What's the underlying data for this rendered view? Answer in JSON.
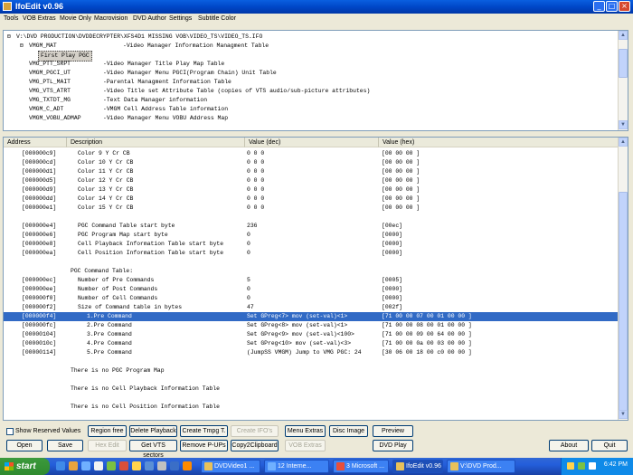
{
  "window": {
    "title": "IfoEdit v0.96",
    "min": "_",
    "max": "□",
    "close": "×"
  },
  "menu": [
    "Tools",
    "VOB Extras",
    "Movie Only",
    "Macrovision",
    "DVD Author",
    "Settings",
    "Subtitle Color"
  ],
  "tree": {
    "root": "V:\\DVD PRODUCTION\\DVDDECRYPTER\\XFS4D1 MISSING VOB\\VIDEO_TS\\VIDEO_TS.IFO",
    "items": [
      {
        "key": "VMGM_MAT",
        "desc": "-Video Manager Information Managment Table"
      },
      {
        "key": "First Play PGC",
        "desc": ""
      },
      {
        "key": "VMG_PTT_SRPT",
        "desc": "-Video Manager Title Play Map Table"
      },
      {
        "key": "VMGM_PGCI_UT",
        "desc": "-Video Manager Menu PGCI(Program Chain) Unit Table"
      },
      {
        "key": "VMG_PTL_MAIT",
        "desc": "-Parental Managment Information Table"
      },
      {
        "key": "VMG_VTS_ATRT",
        "desc": "-Video Title set Attribute Table (copies of VTS audio/sub-picture attributes)"
      },
      {
        "key": "VMG_TXTDT_MG",
        "desc": "-Text Data Manager information"
      },
      {
        "key": "VMGM_C_ADT",
        "desc": "-VMGM Cell Address Table information"
      },
      {
        "key": "VMGM_VOBU_ADMAP",
        "desc": "-Video Manager Menu VOBU Address Map"
      }
    ]
  },
  "table": {
    "headers": [
      "Address",
      "Description",
      "Value (dec)",
      "Value (hex)"
    ],
    "rows": [
      {
        "addr": "[000000c9]",
        "desc": "Color 9 Y Cr CB",
        "dec": "0 0 0",
        "hex": "[00 00 00 ]"
      },
      {
        "addr": "[000000cd]",
        "desc": "Color 10 Y Cr CB",
        "dec": "0 0 0",
        "hex": "[00 00 00 ]"
      },
      {
        "addr": "[000000d1]",
        "desc": "Color 11 Y Cr CB",
        "dec": "0 0 0",
        "hex": "[00 00 00 ]"
      },
      {
        "addr": "[000000d5]",
        "desc": "Color 12 Y Cr CB",
        "dec": "0 0 0",
        "hex": "[00 00 00 ]"
      },
      {
        "addr": "[000000d9]",
        "desc": "Color 13 Y Cr CB",
        "dec": "0 0 0",
        "hex": "[00 00 00 ]"
      },
      {
        "addr": "[000000dd]",
        "desc": "Color 14 Y Cr CB",
        "dec": "0 0 0",
        "hex": "[00 00 00 ]"
      },
      {
        "addr": "[000000e1]",
        "desc": "Color 15 Y Cr CB",
        "dec": "0 0 0",
        "hex": "[00 00 00 ]"
      },
      {
        "addr": "",
        "desc": "",
        "dec": "",
        "hex": ""
      },
      {
        "addr": "[000000e4]",
        "desc": "PGC Command Table start byte",
        "dec": "236",
        "hex": "[00ec]"
      },
      {
        "addr": "[000000e6]",
        "desc": "PGC Program Map start byte",
        "dec": "0",
        "hex": "[0000]"
      },
      {
        "addr": "[000000e8]",
        "desc": "Cell Playback Information Table start byte",
        "dec": "0",
        "hex": "[0000]"
      },
      {
        "addr": "[000000ea]",
        "desc": "Cell Position Information Table start byte",
        "dec": "0",
        "hex": "[0000]"
      },
      {
        "addr": "",
        "desc": "",
        "dec": "",
        "hex": ""
      },
      {
        "addr": "",
        "desc": "PGC Command Table:",
        "dec": "",
        "hex": "",
        "section": true
      },
      {
        "addr": "[000000ec]",
        "desc": "Number of Pre Commands",
        "dec": "5",
        "hex": "[0005]"
      },
      {
        "addr": "[000000ee]",
        "desc": "Number of Post Commands",
        "dec": "0",
        "hex": "[0000]"
      },
      {
        "addr": "[000000f0]",
        "desc": "Number of Cell Commands",
        "dec": "0",
        "hex": "[0000]"
      },
      {
        "addr": "[000000f2]",
        "desc": "Size of Command table in bytes",
        "dec": "47",
        "hex": "[002f]"
      },
      {
        "addr": "[000000f4]",
        "desc": "1.Pre Command",
        "dec": "Set GPreg<7> mov (set-val)<1>",
        "hex": "[71 00 00 07 00 01 00 00 ]",
        "selected": true,
        "indent": true
      },
      {
        "addr": "[000000fc]",
        "desc": "2.Pre Command",
        "dec": "Set GPreg<8> mov (set-val)<1>",
        "hex": "[71 00 00 08 00 01 00 00 ]",
        "indent": true
      },
      {
        "addr": "[00000104]",
        "desc": "3.Pre Command",
        "dec": "Set GPreg<9> mov (set-val)<100>",
        "hex": "[71 00 00 09 00 64 00 00 ]",
        "indent": true
      },
      {
        "addr": "[0000010c]",
        "desc": "4.Pre Command",
        "dec": "Set GPreg<10> mov (set-val)<3>",
        "hex": "[71 00 00 0a 00 03 00 00 ]",
        "indent": true
      },
      {
        "addr": "[00000114]",
        "desc": "5.Pre Command",
        "dec": "(JumpSS VMGM) Jump to VMG PGC: 24",
        "hex": "[30 06 00 18 00 c0 00 00 ]",
        "indent": true
      },
      {
        "addr": "",
        "desc": "",
        "dec": "",
        "hex": ""
      },
      {
        "addr": "",
        "desc": "There is no PGC Program Map",
        "dec": "",
        "hex": "",
        "section": true
      },
      {
        "addr": "",
        "desc": "",
        "dec": "",
        "hex": ""
      },
      {
        "addr": "",
        "desc": "There is no Cell Playback Information Table",
        "dec": "",
        "hex": "",
        "section": true
      },
      {
        "addr": "",
        "desc": "",
        "dec": "",
        "hex": ""
      },
      {
        "addr": "",
        "desc": "There is no Cell Position Information Table",
        "dec": "",
        "hex": "",
        "section": true
      }
    ]
  },
  "controls": {
    "show_reserved": "Show Reserved Values",
    "row1": [
      "Region free",
      "Delete Playback",
      "Create Tmpg T.",
      "Create IFO's",
      "Menu Extras",
      "Disc Image",
      "Preview"
    ],
    "row2": [
      "Open",
      "Save",
      "Hex Edit",
      "Get VTS sectors",
      "Remove P-UPs",
      "Copy2Clipboard",
      "VOB Extras",
      "DVD Play",
      "About",
      "Quit"
    ]
  },
  "taskbar": {
    "start": "start",
    "tasks": [
      "DVDVideo1 ...",
      "12 Interne...",
      "3 Microsoft ...",
      "IfoEdit v0.96",
      "V:\\DVD Prod..."
    ],
    "clock": "6:42 PM"
  },
  "colors": {
    "selection": "#316ac5",
    "titlebar": "#0054e3",
    "taskbar": "#245edb"
  }
}
